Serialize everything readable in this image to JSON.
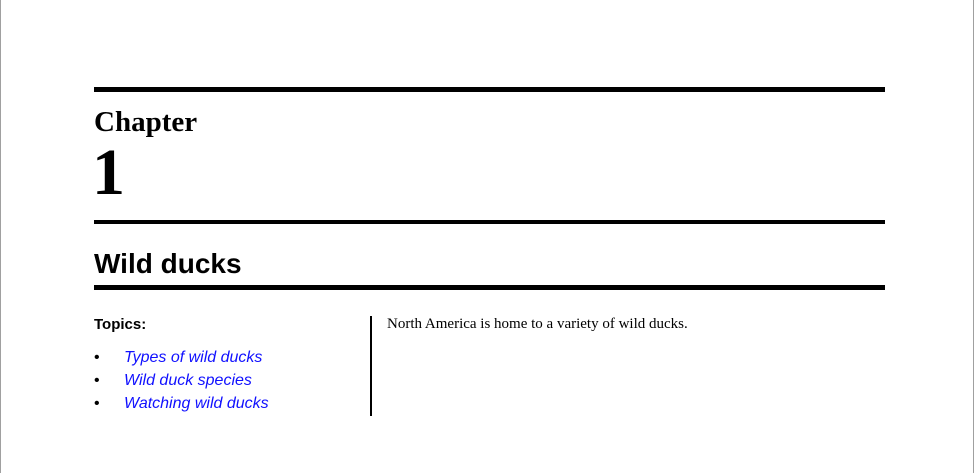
{
  "chapter": {
    "label": "Chapter",
    "number": "1"
  },
  "title": "Wild ducks",
  "topics": {
    "heading": "Topics:",
    "items": [
      {
        "label": "Types of wild ducks"
      },
      {
        "label": "Wild duck species"
      },
      {
        "label": "Watching wild ducks"
      }
    ]
  },
  "body": "North America is home to a variety of wild ducks.",
  "colors": {
    "link": "#1010ff",
    "rule": "#000000"
  }
}
